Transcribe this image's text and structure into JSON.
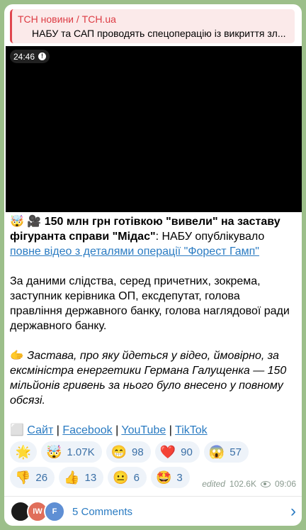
{
  "reply": {
    "author": "ТСН новини / TCH.ua",
    "text": "НАБУ та САП проводять спецоперацію із викриття зл..."
  },
  "video": {
    "duration": "24:46"
  },
  "post": {
    "headline_emoji": "🤯 🎥",
    "headline_bold": "150 млн грн готівкою \"вивели\" на заставу фігуранта справи \"Мідас\"",
    "headline_rest": ": НАБУ опублікувало ",
    "headline_link": "повне відео з деталями операції \"Форест Гамп\"",
    "paragraph2": "За даними слідства, серед причетних, зокрема, заступник керівника ОП, ексдепутат, голова правління державного банку, голова наглядової ради державного банку.",
    "paragraph3_emoji": "🫱",
    "paragraph3_italic": "Застава, про яку йдеться у відео, ймовірно, за ексміністра енергетики Германа Галущенка — 150 мільйонів гривень за нього було внесено у повному обсязі.",
    "links_prefix": "⬜",
    "links": [
      "Сайт",
      "Facebook",
      "YouTube",
      "TikTok"
    ],
    "separator": "|"
  },
  "reactions": {
    "row1": [
      {
        "emoji": "🌟",
        "count": ""
      },
      {
        "emoji": "🤯",
        "count": "1.07K"
      },
      {
        "emoji": "😁",
        "count": "98"
      },
      {
        "emoji": "❤️",
        "count": "90"
      },
      {
        "emoji": "😱",
        "count": "57"
      }
    ],
    "row2": [
      {
        "emoji": "👎",
        "count": "26"
      },
      {
        "emoji": "👍",
        "count": "13"
      },
      {
        "emoji": "😐",
        "count": "6"
      },
      {
        "emoji": "🤩",
        "count": "3"
      }
    ]
  },
  "meta": {
    "edited": "edited",
    "views": "102.6K",
    "time": "09:06"
  },
  "comments": {
    "label": "5 Comments",
    "avatars": [
      "",
      "IW",
      "F"
    ]
  },
  "colors": {
    "link": "#2a7bc2",
    "reply_accent": "#dd3b43",
    "background": "#9cbf8a"
  }
}
